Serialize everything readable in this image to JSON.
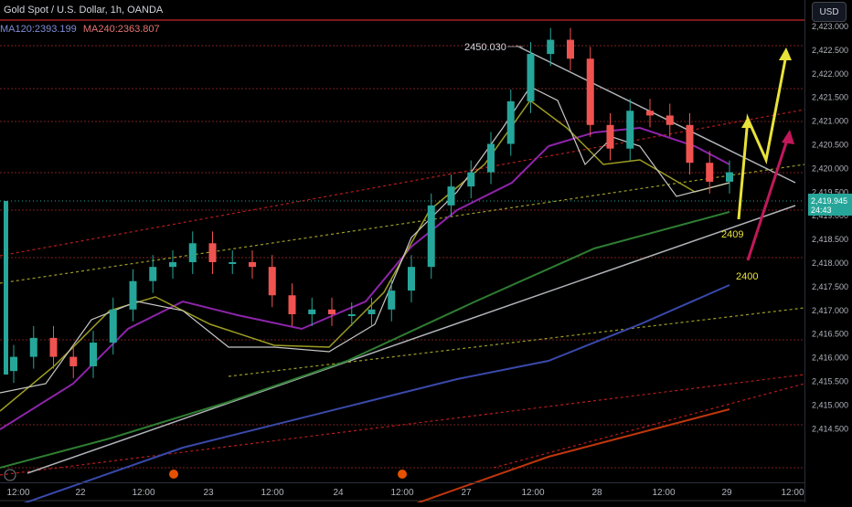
{
  "header": {
    "symbol": "Gold Spot / U.S. Dollar, 1h, OANDA",
    "ma120_label": "MA120:2393.199",
    "ma240_label": "MA240:2363.807",
    "currency_button": "USD"
  },
  "colors": {
    "background": "#000000",
    "up_candle": "#26a69a",
    "down_candle": "#ef5350",
    "ma120": "#7e8bd6",
    "ma240": "#e57373",
    "price_label_bg": "#26a69a",
    "trendline": "#b0b3b8",
    "yellow_arrow": "#e8e23a",
    "magenta_arrow": "#c2185b",
    "ma_fast": "#c7c7c7",
    "ma_mid": "#9e9d24",
    "ma_slow": "#8e24aa",
    "ma_green": "#2e7d32",
    "ma_blue": "#3949ab",
    "ma_orange": "#bf360c"
  },
  "chart_data": {
    "type": "line",
    "y_axis": {
      "ticks": [
        "2,423.000",
        "2,422.500",
        "2,422.000",
        "2,421.500",
        "2,421.000",
        "2,420.500",
        "2,420.000",
        "2,419.500",
        "2,419.000",
        "2,418.500",
        "2,418.000",
        "2,417.500",
        "2,417.000",
        "2,416.500",
        "2,416.000",
        "2,415.500",
        "2,415.000",
        "2,414.500"
      ],
      "ylim": [
        2414.5,
        2423.4
      ]
    },
    "x_axis": {
      "ticks": [
        "12:00",
        "22",
        "12:00",
        "23",
        "12:00",
        "24",
        "12:00",
        "27",
        "12:00",
        "28",
        "12:00",
        "29",
        "12:00"
      ]
    },
    "current_price": {
      "value": "2,419.945",
      "countdown": "24:43"
    },
    "annotations": [
      {
        "text": "2450.030"
      },
      {
        "text": "2409"
      },
      {
        "text": "2400"
      }
    ],
    "series": [
      {
        "values": [
          2416.0,
          2416.4,
          2416.0,
          2415.8,
          2416.3,
          2417.0,
          2417.6,
          2417.9,
          2418.0,
          2418.4,
          2418.0,
          2418.0,
          2417.9,
          2417.3,
          2416.9,
          2417.0,
          2416.9,
          2416.9,
          2417.0,
          2417.4,
          2417.9,
          2419.2,
          2419.6,
          2419.9,
          2420.5,
          2421.4,
          2422.4,
          2422.7,
          2422.3,
          2420.9,
          2420.4,
          2421.2,
          2421.1,
          2420.9,
          2420.1,
          2419.7,
          2419.9
        ]
      }
    ]
  }
}
